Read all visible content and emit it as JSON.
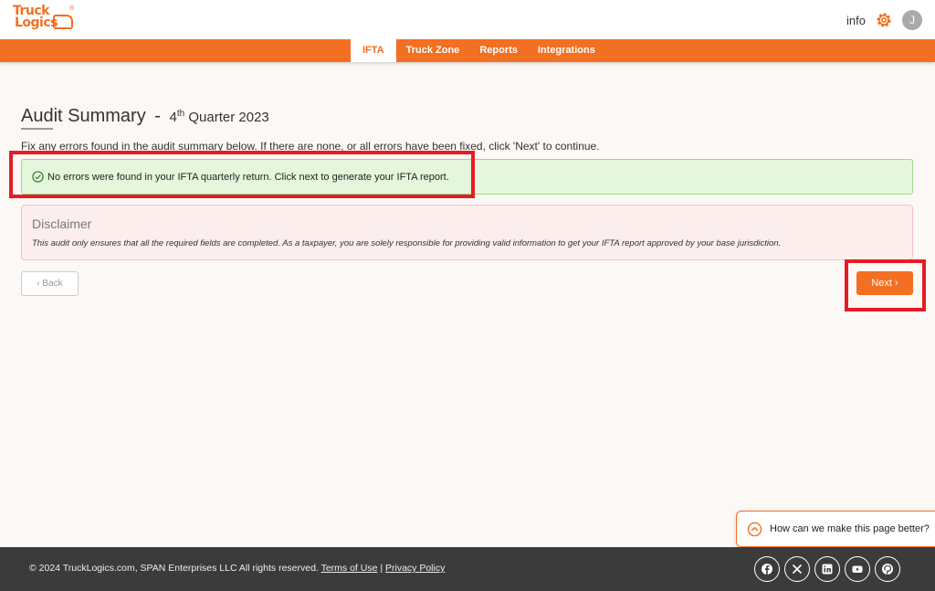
{
  "header": {
    "logo_line1": "Truck",
    "logo_line2": "Logics",
    "logo_reg": "®",
    "info_label": "info",
    "avatar_initial": "J"
  },
  "nav": {
    "items": [
      {
        "label": "IFTA",
        "active": true
      },
      {
        "label": "Truck Zone",
        "active": false
      },
      {
        "label": "Reports",
        "active": false
      },
      {
        "label": "Integrations",
        "active": false
      }
    ]
  },
  "main": {
    "title": "Audit Summary",
    "title_dash": "-",
    "quarter_num": "4",
    "quarter_sup": "th",
    "quarter_rest": " Quarter 2023",
    "instructions": "Fix any errors found in the audit summary below. If there are none, or all errors have been fixed, click 'Next' to continue.",
    "success_message": "No errors were found in your IFTA quarterly return. Click next to generate your IFTA report.",
    "disclaimer_title": "Disclaimer",
    "disclaimer_text": "This audit only ensures that all the required fields are completed. As a taxpayer, you are solely responsible for providing valid information to get your IFTA report approved by your base jurisdiction.",
    "back_label": "‹ Back",
    "next_label": "Next ›"
  },
  "feedback": {
    "label": "How can we make this page better?"
  },
  "footer": {
    "copyright": "© 2024 TruckLogics.com, SPAN Enterprises LLC All rights reserved. ",
    "terms_label": "Terms of Use",
    "separator": " | ",
    "privacy_label": "Privacy Policy",
    "socials": [
      "facebook-icon",
      "x-icon",
      "linkedin-icon",
      "youtube-icon",
      "pinterest-icon"
    ]
  },
  "colors": {
    "brand_orange": "#f36f21",
    "success_bg": "#e4f7dc",
    "disclaimer_bg": "#fdeeee",
    "highlight_red": "#e51c23",
    "footer_bg": "#3b3b3b"
  }
}
